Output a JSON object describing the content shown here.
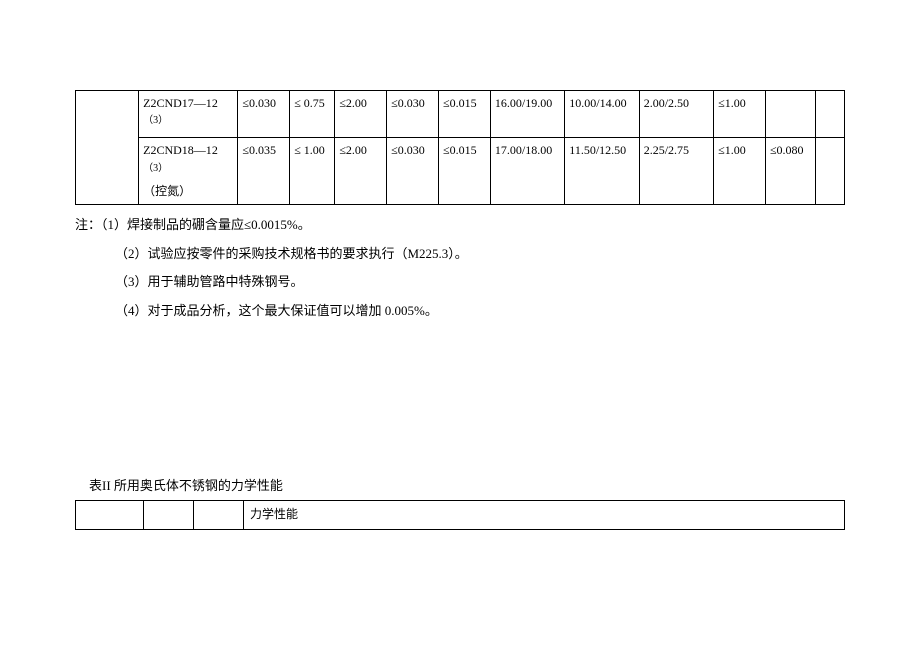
{
  "table1": {
    "rows": [
      {
        "name_a": "Z2CND17—1",
        "name_b": "2",
        "name_sup": "（3）",
        "name_c": "",
        "values": [
          "≤0.030",
          "≤ 0.75",
          "≤2.00",
          "≤0.030",
          "≤0.015",
          "16.00/19.00",
          "10.00/14.00",
          "2.00/2.50",
          "≤1.00",
          "",
          ""
        ]
      },
      {
        "name_a": "Z2CND18—1",
        "name_b": "2",
        "name_sup": "（3）",
        "name_c": "（控氮）",
        "values": [
          "≤0.035",
          "≤ 1.00",
          "≤2.00",
          "≤0.030",
          "≤0.015",
          "17.00/18.00",
          "11.50/12.50",
          "2.25/2.75",
          "≤1.00",
          "≤0.080",
          ""
        ]
      }
    ]
  },
  "notes": {
    "lead": "注：",
    "items": [
      "（1）焊接制品的硼含量应≤0.0015%。",
      "（2）试验应按零件的采购技术规格书的要求执行（M225.3）。",
      "（3）用于辅助管路中特殊钢号。",
      "（4）对于成品分析，这个最大保证值可以增加 0.005%。"
    ]
  },
  "table2": {
    "caption": "表II 所用奥氏体不锈钢的力学性能",
    "header_cell": "力学性能"
  }
}
